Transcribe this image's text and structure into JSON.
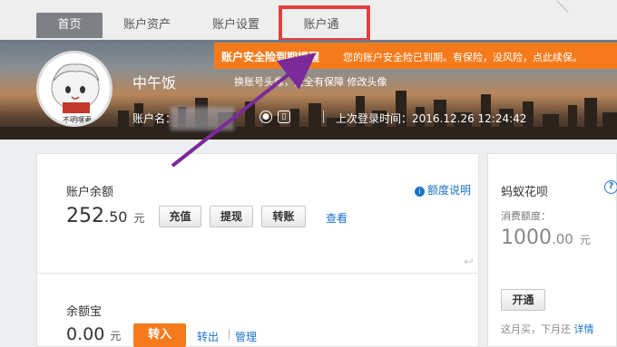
{
  "nav": {
    "tabs": [
      {
        "label": "首页",
        "active": true
      },
      {
        "label": "账户资产",
        "active": false
      },
      {
        "label": "账户设置",
        "active": false
      },
      {
        "label": "账户通",
        "active": false,
        "highlighted": true
      }
    ]
  },
  "profile": {
    "name": "中午饭",
    "tagline": "换账号头像，安全有保障 修改头像",
    "account_label": "账户名：",
    "last_login": "上次登录时间：2016.12.26 12:24:42",
    "avatar_caption": "不明嘿妻"
  },
  "alert": {
    "title": "账户安全险到期提醒",
    "message": "您的账户安全险已到期。有保险，没风险，点此续保。",
    "color": "#f47a1c"
  },
  "balance": {
    "label": "账户余额",
    "integer": "252",
    "decimal": ".50",
    "unit": "元",
    "buttons": [
      "充值",
      "提现",
      "转账"
    ],
    "view_link": "查看",
    "quota_link": "额度说明"
  },
  "yuebao": {
    "label": "余额宝",
    "integer": "0",
    "decimal": ".00",
    "unit": "元",
    "transfer_in": "转入",
    "transfer_out": "转出",
    "manage": "管理"
  },
  "huabei": {
    "title": "蚂蚁花呗",
    "quota_label": "消费额度：",
    "integer": "1000",
    "decimal": ".00",
    "unit": "元",
    "open_button": "开通",
    "note": "这月买，下月还",
    "details": "详情"
  },
  "colors": {
    "accent_orange": "#f47a1c",
    "link_blue": "#1a73c8",
    "highlight_red": "#e63f3f",
    "arrow_purple": "#7b2a9a"
  }
}
